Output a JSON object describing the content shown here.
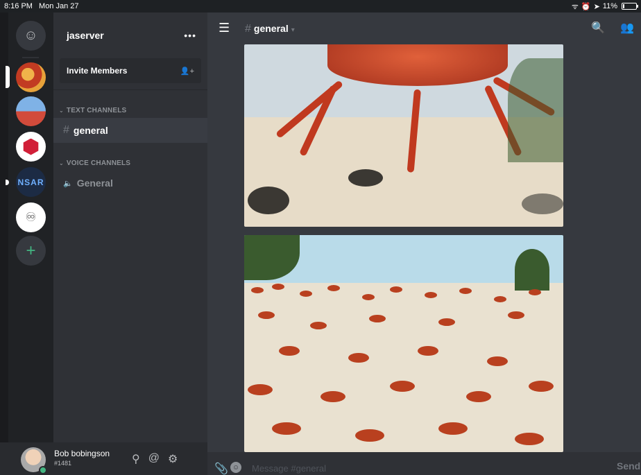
{
  "status_bar": {
    "time": "8:16 PM",
    "date": "Mon Jan 27",
    "battery": "11%"
  },
  "guilds": {
    "nsar_label": "NSAR",
    "add_label": "+"
  },
  "sidebar": {
    "server_name": "jaserver",
    "more_label": "•••",
    "invite_label": "Invite Members",
    "text_category": "TEXT CHANNELS",
    "voice_category": "VOICE CHANNELS",
    "text_channels": [
      {
        "name": "general"
      }
    ],
    "voice_channels": [
      {
        "name": "General"
      }
    ]
  },
  "user": {
    "name": "Bob bobingson",
    "discriminator": "#1481"
  },
  "header": {
    "channel": "general"
  },
  "composer": {
    "placeholder": "Message #general",
    "send_label": "Send"
  },
  "colors": {
    "accent_green": "#43b581",
    "bg": "#36393f",
    "sidebar": "#2f3136",
    "rail": "#202225"
  }
}
